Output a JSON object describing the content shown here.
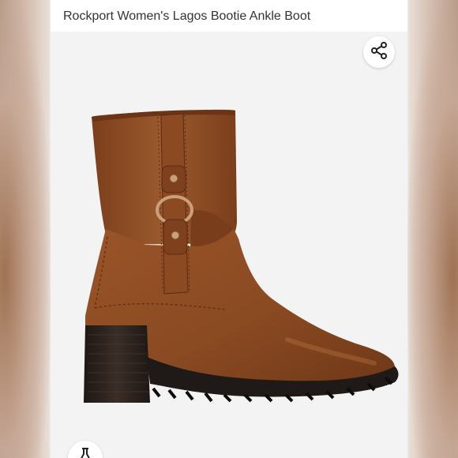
{
  "product": {
    "title": "Rockport Women's Lagos Bootie Ankle Boot"
  },
  "image": {
    "alt": "Rockport Women's Lagos Bootie Ankle Boot"
  },
  "icons": {
    "share": "share-icon",
    "bottom": "flask-icon"
  },
  "colors": {
    "leather": "#8a4a22",
    "leather_light": "#a35e30",
    "heel": "#2a1f1a",
    "sole": "#1f1a17",
    "hardware": "#c9a07a"
  }
}
